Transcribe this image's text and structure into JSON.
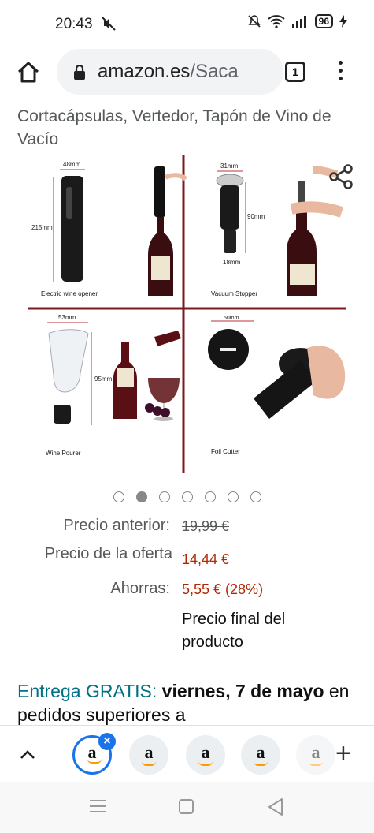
{
  "status_bar": {
    "time": "20:43",
    "battery": "96"
  },
  "browser": {
    "url_host": "amazon.es",
    "url_path": "/Saca",
    "tab_count": "1"
  },
  "product": {
    "title": "Cortacápsulas, Vertedor, Tapón de Vino de Vacío",
    "image_labels": {
      "electric": "Electric wine opener",
      "vacuum": "Vacuum Stopper",
      "pourer": "Wine Pourer",
      "foil": "Foil Cutter"
    },
    "dims": {
      "d48": "48mm",
      "d215": "215mm",
      "d31": "31mm",
      "d90": "90mm",
      "d18": "18mm",
      "d53": "53mm",
      "d95": "95mm",
      "d50": "50mm"
    },
    "carousel_dots": 7,
    "carousel_active": 1
  },
  "pricing": {
    "prev_label": "Precio anterior:",
    "prev_value": "19,99 €",
    "offer_label": "Precio de la oferta",
    "offer_value": "14,44 €",
    "savings_label": "Ahorras:",
    "savings_value": "5,55 € (28%)",
    "final_note": "Precio final del producto"
  },
  "delivery": {
    "free_label": "Entrega GRATIS:",
    "date": "viernes, 7 de mayo",
    "rest": " en pedidos superiores a"
  },
  "colors": {
    "accent": "#1a73e8",
    "teal": "#007185",
    "price_red": "#b12704",
    "divider_maroon": "#7a1a1f"
  }
}
